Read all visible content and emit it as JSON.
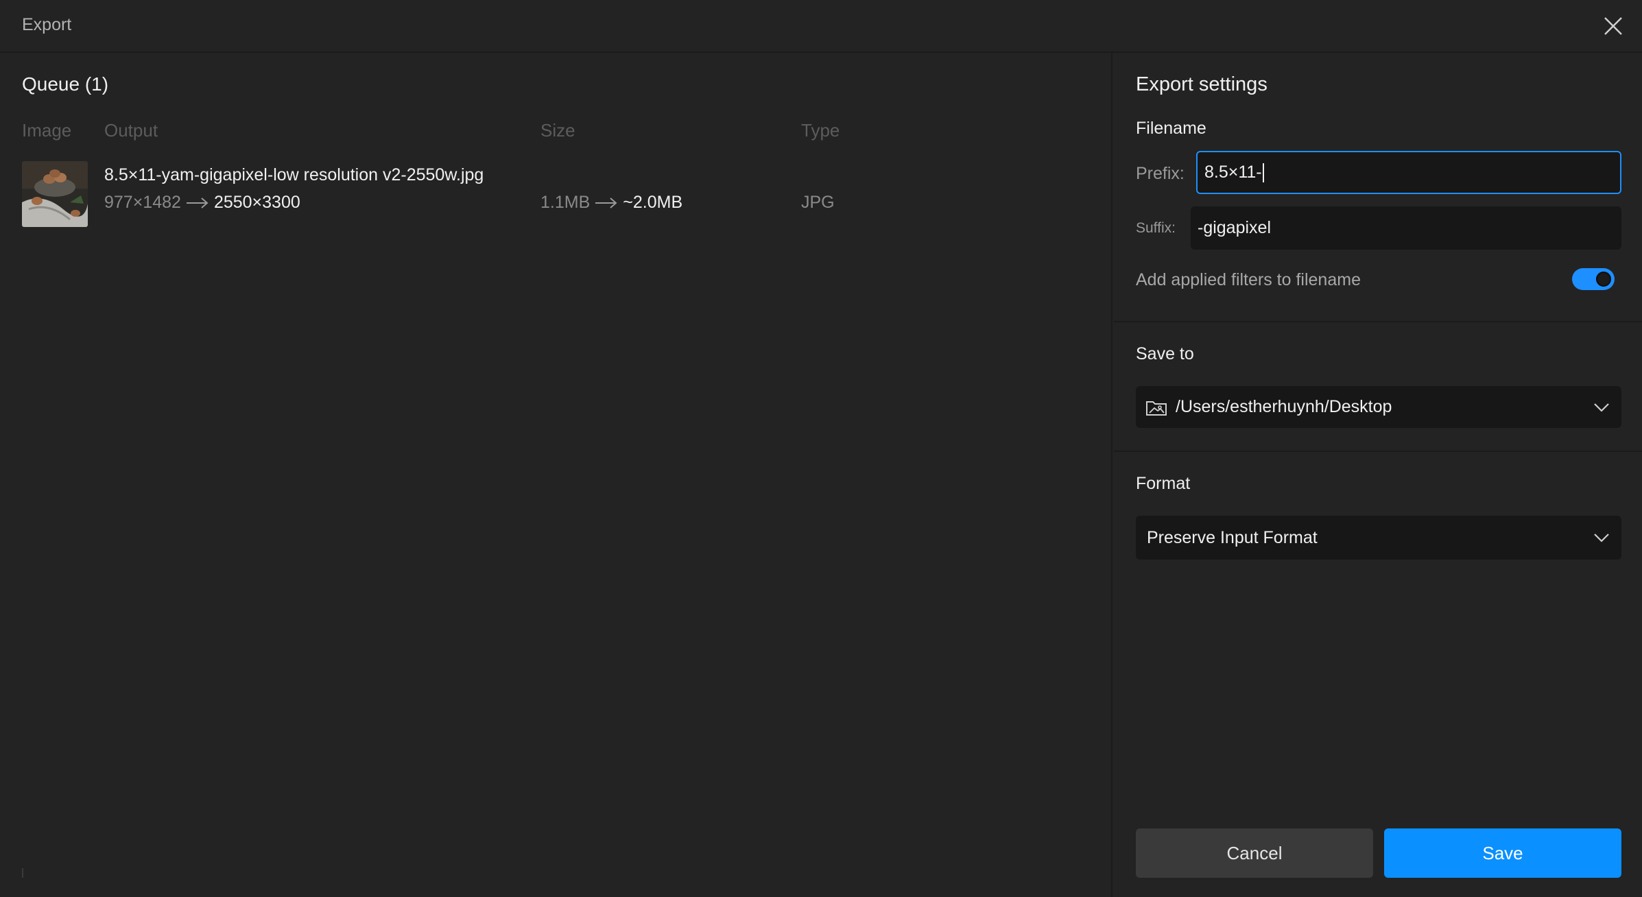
{
  "window": {
    "title": "Export"
  },
  "queue": {
    "title": "Queue (1)",
    "columns": {
      "image": "Image",
      "output": "Output",
      "size": "Size",
      "type": "Type"
    },
    "items": [
      {
        "filename": "8.5×11-yam-gigapixel-low resolution v2-2550w.jpg",
        "input_dims": "977×1482",
        "output_dims": "2550×3300",
        "input_size": "1.1MB",
        "output_size": "~2.0MB",
        "type": "JPG"
      }
    ]
  },
  "settings": {
    "title": "Export settings",
    "filename": {
      "heading": "Filename",
      "prefix_label": "Prefix:",
      "prefix_value": "8.5×11-",
      "suffix_label": "Suffix:",
      "suffix_value": "-gigapixel",
      "filters_label": "Add applied filters to filename",
      "filters_enabled": true
    },
    "save_to": {
      "heading": "Save to",
      "path": "/Users/estherhuynh/Desktop"
    },
    "format": {
      "heading": "Format",
      "selected": "Preserve Input Format"
    },
    "buttons": {
      "cancel": "Cancel",
      "save": "Save"
    }
  },
  "colors": {
    "accent": "#0a90ff",
    "background": "#232323",
    "field": "#171717"
  },
  "icons": {
    "close": "close-icon",
    "folder": "folder-image-icon",
    "chevron": "chevron-down-icon",
    "arrow": "arrow-right-icon"
  }
}
